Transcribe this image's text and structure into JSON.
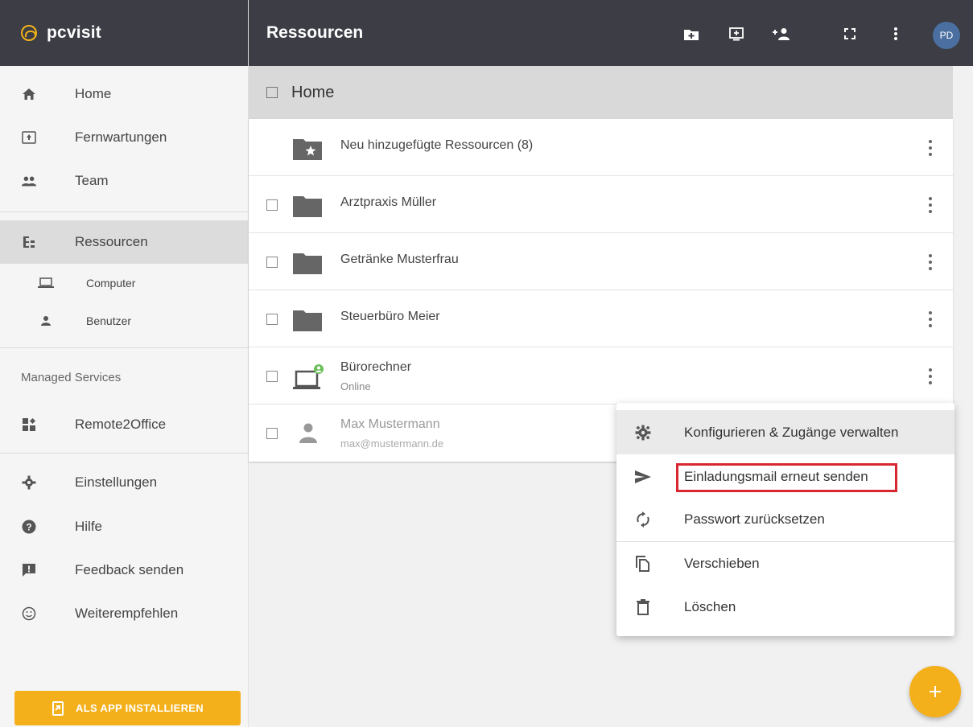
{
  "brand": {
    "name": "pcvisit"
  },
  "sidebar": {
    "items": [
      {
        "label": "Home",
        "icon": "home-icon"
      },
      {
        "label": "Fernwartungen",
        "icon": "remote-screen-icon"
      },
      {
        "label": "Team",
        "icon": "team-icon"
      },
      {
        "label": "Ressourcen",
        "icon": "resources-tree-icon"
      },
      {
        "label": "Computer",
        "icon": "laptop-icon"
      },
      {
        "label": "Benutzer",
        "icon": "user-icon"
      }
    ],
    "section_label": "Managed Services",
    "managed": [
      {
        "label": "Remote2Office",
        "icon": "dashboard-icon"
      }
    ],
    "bottom": [
      {
        "label": "Einstellungen",
        "icon": "gear-icon"
      },
      {
        "label": "Hilfe",
        "icon": "help-icon"
      },
      {
        "label": "Feedback senden",
        "icon": "feedback-icon"
      },
      {
        "label": "Weiterempfehlen",
        "icon": "smiley-icon"
      }
    ],
    "install_button": "ALS APP INSTALLIEREN"
  },
  "topbar": {
    "title": "Ressourcen",
    "avatar": "PD"
  },
  "breadcrumb": {
    "label": "Home"
  },
  "list": [
    {
      "name": "Neu hinzugefügte Ressourcen (8)",
      "sub": "",
      "icon": "starred-folder-icon"
    },
    {
      "name": "Arztpraxis Müller",
      "sub": "",
      "icon": "folder-icon"
    },
    {
      "name": "Getränke Musterfrau",
      "sub": "",
      "icon": "folder-icon"
    },
    {
      "name": "Steuerbüro Meier",
      "sub": "",
      "icon": "folder-icon"
    },
    {
      "name": "Bürorechner",
      "sub": "Online",
      "icon": "computer-online-icon"
    },
    {
      "name": "Max Mustermann",
      "sub": "max@mustermann.de",
      "icon": "user-icon"
    }
  ],
  "context_menu": [
    {
      "label": "Konfigurieren & Zugänge verwalten",
      "icon": "gear-icon"
    },
    {
      "label": "Einladungsmail erneut senden",
      "icon": "send-icon"
    },
    {
      "label": "Passwort zurücksetzen",
      "icon": "refresh-icon"
    },
    {
      "label": "Verschieben",
      "icon": "copy-icon"
    },
    {
      "label": "Löschen",
      "icon": "trash-icon"
    }
  ],
  "colors": {
    "accent": "#f4b01b",
    "topbar": "#3c3d45",
    "highlight": "#d8272e"
  }
}
